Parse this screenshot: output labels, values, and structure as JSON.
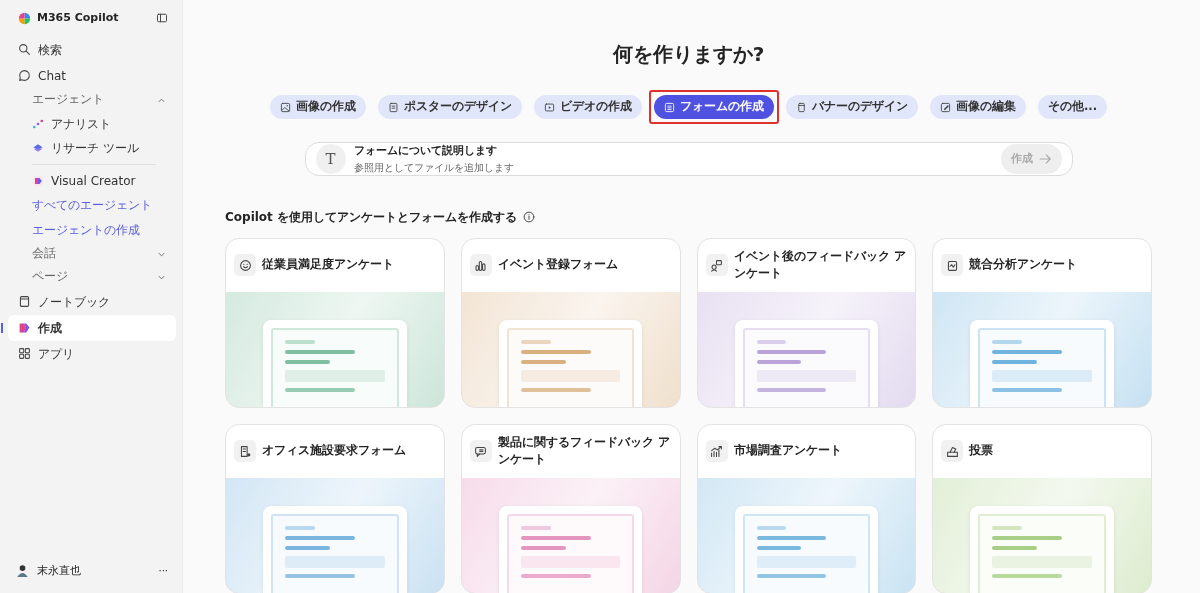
{
  "app": {
    "title": "M365 Copilot"
  },
  "sidebar": {
    "items": [
      {
        "kind": "nav",
        "label": "検索",
        "selected": false
      },
      {
        "kind": "nav",
        "label": "Chat",
        "selected": false
      },
      {
        "kind": "section",
        "label": "エージェント",
        "expanded": true
      },
      {
        "kind": "agent",
        "label": "アナリスト"
      },
      {
        "kind": "agent",
        "label": "リサーチ ツール"
      },
      {
        "kind": "divider"
      },
      {
        "kind": "agent",
        "label": "Visual Creator"
      },
      {
        "kind": "link",
        "label": "すべてのエージェント"
      },
      {
        "kind": "link",
        "label": "エージェントの作成"
      },
      {
        "kind": "section",
        "label": "会話",
        "expanded": false
      },
      {
        "kind": "section",
        "label": "ページ",
        "expanded": false
      },
      {
        "kind": "nav",
        "label": "ノートブック",
        "selected": false
      },
      {
        "kind": "nav",
        "label": "作成",
        "selected": true
      },
      {
        "kind": "nav",
        "label": "アプリ",
        "selected": false
      }
    ]
  },
  "user": {
    "name": "末永直也",
    "more": "···"
  },
  "heading": "何を作りますか?",
  "tabs": [
    {
      "label": "画像の作成",
      "selected": false,
      "highlighted": false
    },
    {
      "label": "ポスターのデザイン",
      "selected": false,
      "highlighted": false
    },
    {
      "label": "ビデオの作成",
      "selected": false,
      "highlighted": false
    },
    {
      "label": "フォームの作成",
      "selected": true,
      "highlighted": true
    },
    {
      "label": "バナーのデザイン",
      "selected": false,
      "highlighted": false
    },
    {
      "label": "画像の編集",
      "selected": false,
      "highlighted": false
    },
    {
      "label": "その他...",
      "selected": false,
      "highlighted": false
    }
  ],
  "prompt": {
    "icon_letter": "T",
    "placeholder": "フォームについて説明します",
    "hint": "参照用としてファイルを追加します",
    "button": "作成",
    "button_disabled": true
  },
  "section_title": "Copilot を使用してアンケートとフォームを作成する",
  "cards": [
    {
      "title": "従業員満足度アンケート",
      "color": "#7fbfa0"
    },
    {
      "title": "イベント登録フォーム",
      "color": "#d9b080"
    },
    {
      "title": "イベント後のフィードバック アンケート",
      "color": "#b9a3d8"
    },
    {
      "title": "競合分析アンケート",
      "color": "#6fb3df"
    },
    {
      "title": "オフィス施設要求フォーム",
      "color": "#7ab5e0"
    },
    {
      "title": "製品に関するフィードバック アンケート",
      "color": "#e596bf"
    },
    {
      "title": "市場調査アンケート",
      "color": "#79b9e0"
    },
    {
      "title": "投票",
      "color": "#a9cf86"
    }
  ]
}
